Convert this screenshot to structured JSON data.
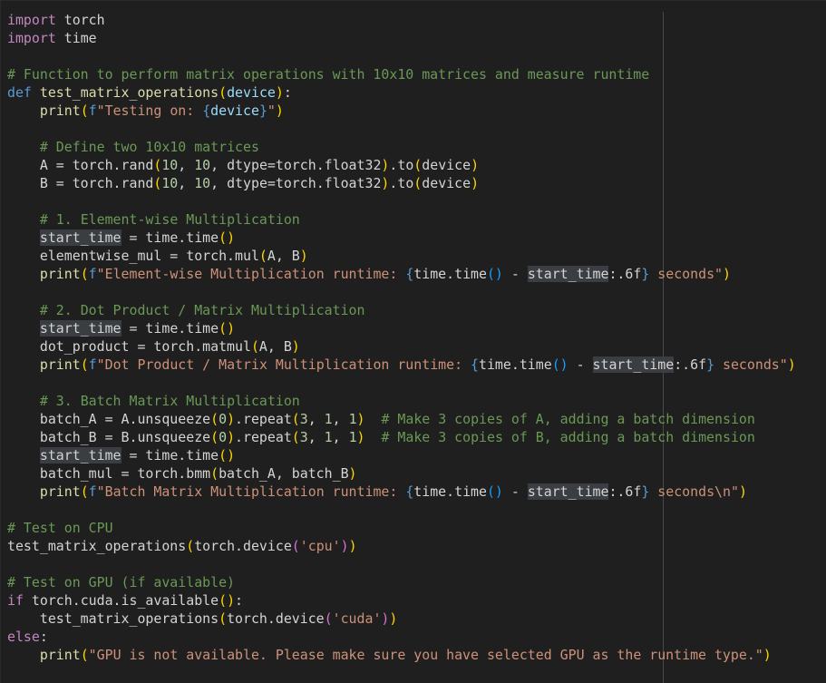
{
  "editor": {
    "lines": [
      [
        [
          "kw",
          "import"
        ],
        [
          "txt",
          " torch"
        ]
      ],
      [
        [
          "kw",
          "import"
        ],
        [
          "txt",
          " time"
        ]
      ],
      [],
      [
        [
          "cm",
          "# Function to perform matrix operations with 10x10 matrices and measure runtime"
        ]
      ],
      [
        [
          "kw2",
          "def"
        ],
        [
          "txt",
          " "
        ],
        [
          "fn",
          "test_matrix_operations"
        ],
        [
          "b1",
          "("
        ],
        [
          "var",
          "device"
        ],
        [
          "b1",
          ")"
        ],
        [
          "txt",
          ":"
        ]
      ],
      [
        [
          "txt",
          "    "
        ],
        [
          "fn",
          "print"
        ],
        [
          "b1",
          "("
        ],
        [
          "kw2",
          "f"
        ],
        [
          "str",
          "\"Testing on: "
        ],
        [
          "kw2",
          "{"
        ],
        [
          "var",
          "device"
        ],
        [
          "kw2",
          "}"
        ],
        [
          "str",
          "\""
        ],
        [
          "b1",
          ")"
        ]
      ],
      [],
      [
        [
          "txt",
          "    "
        ],
        [
          "cm",
          "# Define two 10x10 matrices"
        ]
      ],
      [
        [
          "txt",
          "    A = torch.rand"
        ],
        [
          "b1",
          "("
        ],
        [
          "num",
          "10"
        ],
        [
          "txt",
          ", "
        ],
        [
          "num",
          "10"
        ],
        [
          "txt",
          ", dtype=torch.float32"
        ],
        [
          "b1",
          ")"
        ],
        [
          "txt",
          ".to"
        ],
        [
          "b1",
          "("
        ],
        [
          "txt",
          "device"
        ],
        [
          "b1",
          ")"
        ]
      ],
      [
        [
          "txt",
          "    B = torch.rand"
        ],
        [
          "b1",
          "("
        ],
        [
          "num",
          "10"
        ],
        [
          "txt",
          ", "
        ],
        [
          "num",
          "10"
        ],
        [
          "txt",
          ", dtype=torch.float32"
        ],
        [
          "b1",
          ")"
        ],
        [
          "txt",
          ".to"
        ],
        [
          "b1",
          "("
        ],
        [
          "txt",
          "device"
        ],
        [
          "b1",
          ")"
        ]
      ],
      [],
      [
        [
          "txt",
          "    "
        ],
        [
          "cm",
          "# 1. Element-wise Multiplication"
        ]
      ],
      [
        [
          "txt",
          "    "
        ],
        [
          "hl",
          "start_time"
        ],
        [
          "txt",
          " = time.time"
        ],
        [
          "b1",
          "()"
        ]
      ],
      [
        [
          "txt",
          "    elementwise_mul = torch.mul"
        ],
        [
          "b1",
          "("
        ],
        [
          "txt",
          "A, B"
        ],
        [
          "b1",
          ")"
        ]
      ],
      [
        [
          "txt",
          "    "
        ],
        [
          "fn",
          "print"
        ],
        [
          "b1",
          "("
        ],
        [
          "kw2",
          "f"
        ],
        [
          "str",
          "\"Element-wise Multiplication runtime: "
        ],
        [
          "kw2",
          "{"
        ],
        [
          "txt",
          "time.time"
        ],
        [
          "b3",
          "()"
        ],
        [
          "txt",
          " - "
        ],
        [
          "hl",
          "start_time"
        ],
        [
          "txt",
          ":.6f"
        ],
        [
          "kw2",
          "}"
        ],
        [
          "str",
          " seconds\""
        ],
        [
          "b1",
          ")"
        ]
      ],
      [],
      [
        [
          "txt",
          "    "
        ],
        [
          "cm",
          "# 2. Dot Product / Matrix Multiplication"
        ]
      ],
      [
        [
          "txt",
          "    "
        ],
        [
          "hl",
          "start_time"
        ],
        [
          "txt",
          " = time.time"
        ],
        [
          "b1",
          "()"
        ]
      ],
      [
        [
          "txt",
          "    dot_product = torch.matmul"
        ],
        [
          "b1",
          "("
        ],
        [
          "txt",
          "A, B"
        ],
        [
          "b1",
          ")"
        ]
      ],
      [
        [
          "txt",
          "    "
        ],
        [
          "fn",
          "print"
        ],
        [
          "b1",
          "("
        ],
        [
          "kw2",
          "f"
        ],
        [
          "str",
          "\"Dot Product / Matrix Multiplication runtime: "
        ],
        [
          "kw2",
          "{"
        ],
        [
          "txt",
          "time.time"
        ],
        [
          "b3",
          "()"
        ],
        [
          "txt",
          " - "
        ],
        [
          "hl",
          "start_time"
        ],
        [
          "txt",
          ":.6f"
        ],
        [
          "kw2",
          "}"
        ],
        [
          "str",
          " seconds\""
        ],
        [
          "b1",
          ")"
        ]
      ],
      [],
      [
        [
          "txt",
          "    "
        ],
        [
          "cm",
          "# 3. Batch Matrix Multiplication"
        ]
      ],
      [
        [
          "txt",
          "    batch_A = A.unsqueeze"
        ],
        [
          "b1",
          "("
        ],
        [
          "num",
          "0"
        ],
        [
          "b1",
          ")"
        ],
        [
          "txt",
          ".repeat"
        ],
        [
          "b1",
          "("
        ],
        [
          "num",
          "3"
        ],
        [
          "txt",
          ", "
        ],
        [
          "num",
          "1"
        ],
        [
          "txt",
          ", "
        ],
        [
          "num",
          "1"
        ],
        [
          "b1",
          ")"
        ],
        [
          "txt",
          "  "
        ],
        [
          "cm",
          "# Make 3 copies of A, adding a batch dimension"
        ]
      ],
      [
        [
          "txt",
          "    batch_B = B.unsqueeze"
        ],
        [
          "b1",
          "("
        ],
        [
          "num",
          "0"
        ],
        [
          "b1",
          ")"
        ],
        [
          "txt",
          ".repeat"
        ],
        [
          "b1",
          "("
        ],
        [
          "num",
          "3"
        ],
        [
          "txt",
          ", "
        ],
        [
          "num",
          "1"
        ],
        [
          "txt",
          ", "
        ],
        [
          "num",
          "1"
        ],
        [
          "b1",
          ")"
        ],
        [
          "txt",
          "  "
        ],
        [
          "cm",
          "# Make 3 copies of B, adding a batch dimension"
        ]
      ],
      [
        [
          "txt",
          "    "
        ],
        [
          "hl",
          "start_time"
        ],
        [
          "txt",
          " = time.time"
        ],
        [
          "b1",
          "()"
        ]
      ],
      [
        [
          "txt",
          "    batch_mul = torch.bmm"
        ],
        [
          "b1",
          "("
        ],
        [
          "txt",
          "batch_A, batch_B"
        ],
        [
          "b1",
          ")"
        ]
      ],
      [
        [
          "txt",
          "    "
        ],
        [
          "fn",
          "print"
        ],
        [
          "b1",
          "("
        ],
        [
          "kw2",
          "f"
        ],
        [
          "str",
          "\"Batch Matrix Multiplication runtime: "
        ],
        [
          "kw2",
          "{"
        ],
        [
          "txt",
          "time.time"
        ],
        [
          "b3",
          "()"
        ],
        [
          "txt",
          " - "
        ],
        [
          "hl",
          "start_time"
        ],
        [
          "txt",
          ":.6f"
        ],
        [
          "kw2",
          "}"
        ],
        [
          "str",
          " seconds\\n\""
        ],
        [
          "b1",
          ")"
        ]
      ],
      [],
      [
        [
          "cm",
          "# Test on CPU"
        ]
      ],
      [
        [
          "txt",
          "test_matrix_operations"
        ],
        [
          "b1",
          "("
        ],
        [
          "txt",
          "torch.device"
        ],
        [
          "b2",
          "("
        ],
        [
          "str",
          "'cpu'"
        ],
        [
          "b2",
          ")"
        ],
        [
          "b1",
          ")"
        ]
      ],
      [],
      [
        [
          "cm",
          "# Test on GPU (if available)"
        ]
      ],
      [
        [
          "kw",
          "if"
        ],
        [
          "txt",
          " torch.cuda.is_available"
        ],
        [
          "b1",
          "()"
        ],
        [
          "txt",
          ":"
        ]
      ],
      [
        [
          "txt",
          "    test_matrix_operations"
        ],
        [
          "b1",
          "("
        ],
        [
          "txt",
          "torch.device"
        ],
        [
          "b2",
          "("
        ],
        [
          "str",
          "'cuda'"
        ],
        [
          "b2",
          ")"
        ],
        [
          "b1",
          ")"
        ]
      ],
      [
        [
          "kw",
          "else"
        ],
        [
          "txt",
          ":"
        ]
      ],
      [
        [
          "txt",
          "    "
        ],
        [
          "fn",
          "print"
        ],
        [
          "b1",
          "("
        ],
        [
          "str",
          "\"GPU is not available. Please make sure you have selected GPU as the runtime type.\""
        ],
        [
          "b1",
          ")"
        ]
      ]
    ]
  }
}
